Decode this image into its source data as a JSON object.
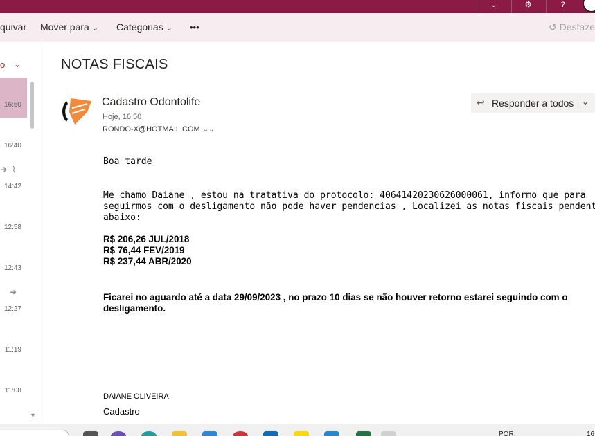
{
  "toolbar": {
    "archive_label": "quivar",
    "move_label": "Mover para",
    "categories_label": "Categorias",
    "more_label": "•••",
    "undo_label": "Desfaze"
  },
  "message_list": {
    "filter_label": "o",
    "times": [
      "16:50",
      "16:40",
      "14:42",
      "12:58",
      "12:43",
      "12:27",
      "11:19",
      "11:08"
    ]
  },
  "message": {
    "subject": "NOTAS FISCAIS",
    "sender_name": "Cadastro Odontolife",
    "sent_time": "Hoje, 16:50",
    "to": "RONDO-X@HOTMAIL.COM",
    "reply_all_label": "Responder a todos",
    "body": {
      "greeting": "Boa tarde",
      "para1": [
        "Me chamo Daiane , estou na tratativa do protocolo: 40641420230626000061, informo que para",
        "seguirmos com o desligamento não pode haver pendencias , Localizei as notas fiscais pendentes de envio",
        "abaixo:"
      ],
      "invoices": [
        "R$ 206,26    JUL/2018",
        "R$ 76,44    FEV/2019",
        "R$ 237,44    ABR/2020"
      ],
      "closing": [
        "Ficarei no aguardo até a data 29/09/2023 , no prazo 10 dias se não houver retorno estarei seguindo com o",
        "desligamento."
      ]
    },
    "signature": {
      "name": "DAIANE OLIVEIRA",
      "role": "Cadastro"
    }
  },
  "taskbar": {
    "language": "POR",
    "clock": "16"
  },
  "colors": {
    "header": "#8b1a44",
    "toolbar_bg": "#f7ecf0",
    "selected_item": "#dcb6c7",
    "logo_orange": "#f08a3c"
  }
}
